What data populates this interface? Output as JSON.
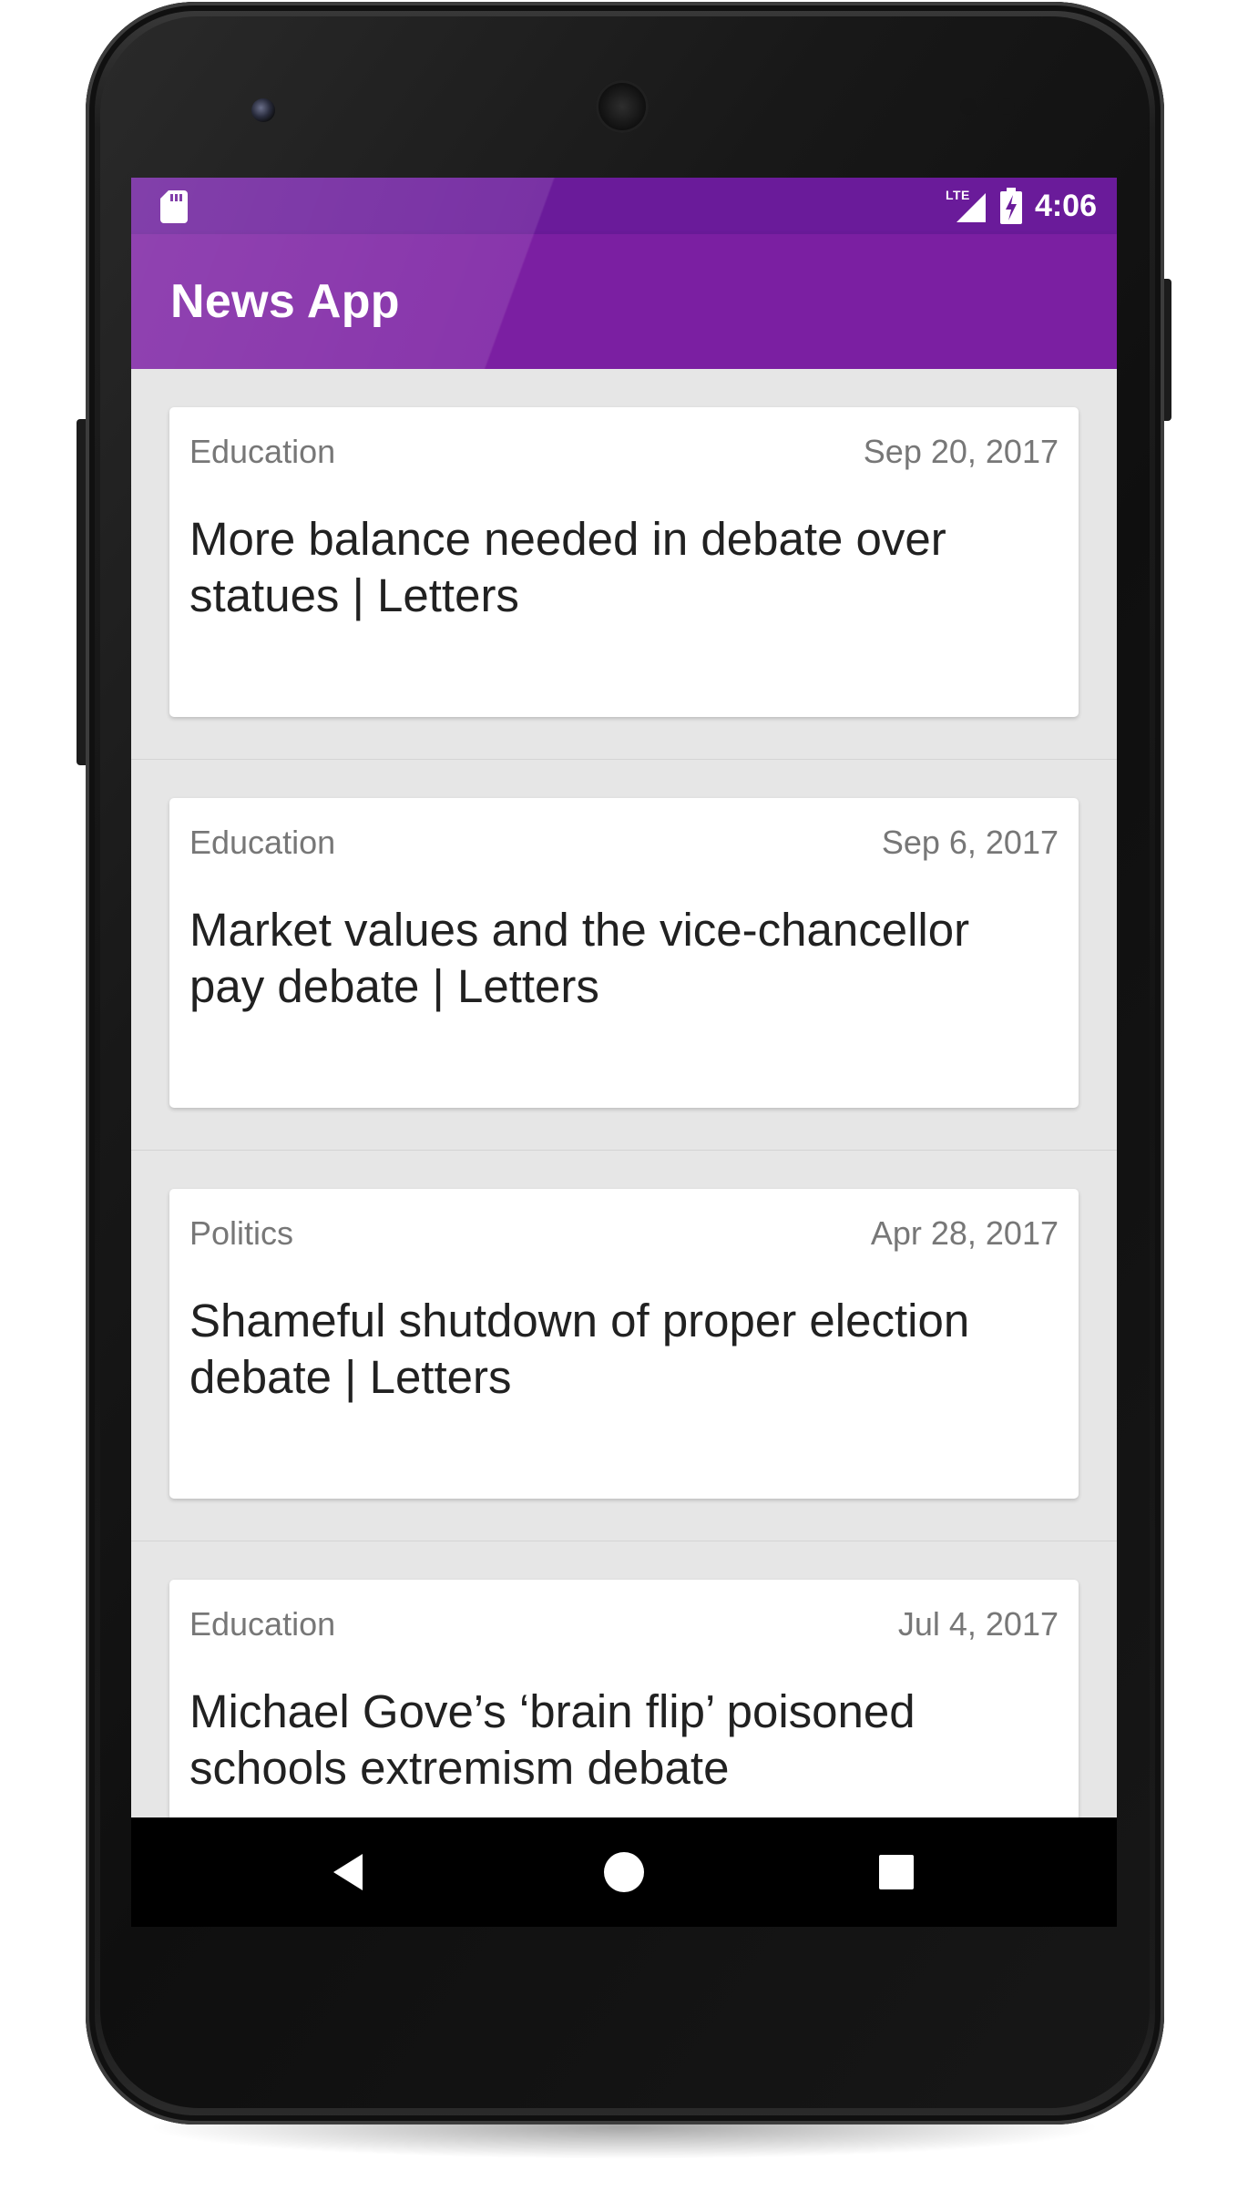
{
  "status_bar": {
    "network": "LTE",
    "time": "4:06"
  },
  "app_bar": {
    "title": "News App"
  },
  "articles": [
    {
      "section": "Education",
      "date": "Sep 20, 2017",
      "title": "More balance needed in debate over statues | Letters"
    },
    {
      "section": "Education",
      "date": "Sep 6, 2017",
      "title": "Market values and the vice-chancellor pay debate | Letters"
    },
    {
      "section": "Politics",
      "date": "Apr 28, 2017",
      "title": "Shameful shutdown of proper election debate | Letters"
    },
    {
      "section": "Education",
      "date": "Jul 4, 2017",
      "title": "Michael Gove’s ‘brain flip’ poisoned schools extremism debate"
    }
  ],
  "nav_bar": {
    "icons": [
      "back-icon",
      "home-icon",
      "recents-icon"
    ]
  },
  "colors": {
    "primary": "#7b1fa2",
    "primary_dark": "#6a1b9a",
    "list_background": "#e6e6e6",
    "card_background": "#ffffff"
  }
}
